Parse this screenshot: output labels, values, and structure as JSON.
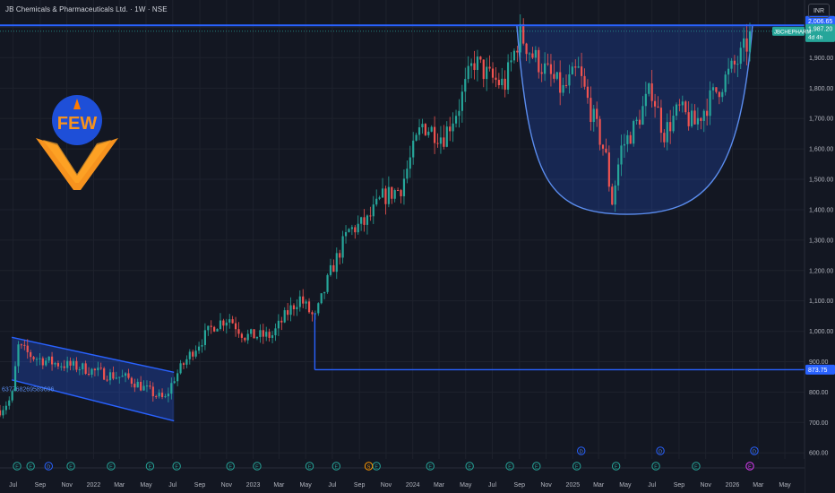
{
  "header": {
    "title": "JB Chemicals & Pharmaceuticals Ltd. · 1W · NSE",
    "currency": "INR"
  },
  "logo": {
    "text": "FEW"
  },
  "price_labels": {
    "resistance": "2,006.65",
    "last": "1,987.20",
    "ticker": "JBCHEPHARM",
    "countdown": "4d 4h",
    "support": "873.75",
    "channel_note": "637768269589696"
  },
  "colors": {
    "background": "#131722",
    "up": "#26a69a",
    "down": "#ef5350",
    "line": "#2962ff",
    "grid": "#1e222d",
    "axis_text": "#b2b5be"
  },
  "event_markers": {
    "earnings": [
      "Jul 2021",
      "Aug 2021",
      "Nov 2021",
      "Feb 2022",
      "May 2022",
      "Jul 2022",
      "Nov 2022",
      "Jan 2023",
      "May 2023",
      "Jul 2023",
      "Oct 2023",
      "Feb 2024",
      "May 2024",
      "Aug 2024",
      "Oct 2024",
      "Jan 2025",
      "Apr 2025",
      "Jul 2025",
      "Oct 2025",
      "Feb 2026"
    ],
    "dividends": [
      "Sep 2021",
      "Jan 2025",
      "Jul 2025",
      "Feb 2026"
    ],
    "splits": [
      "Sep 2023"
    ]
  },
  "chart_data": {
    "type": "candlestick",
    "title": "JB Chemicals & Pharmaceuticals Ltd. · 1W · NSE",
    "x_tick_labels": [
      "Jul",
      "Sep",
      "Nov",
      "2022",
      "Mar",
      "May",
      "Jul",
      "Sep",
      "Nov",
      "2023",
      "Mar",
      "May",
      "Jul",
      "Sep",
      "Nov",
      "2024",
      "Mar",
      "May",
      "Jul",
      "Sep",
      "Nov",
      "2025",
      "Mar",
      "May",
      "Jul",
      "Sep",
      "Nov",
      "2026",
      "Mar",
      "May"
    ],
    "y_ticks": [
      600,
      700,
      800,
      900,
      1000,
      1100,
      1200,
      1300,
      1400,
      1500,
      1600,
      1700,
      1800,
      1900,
      2000
    ],
    "y_tick_labels": [
      "600.00",
      "700.00",
      "800.00",
      "900.00",
      "1,000.00",
      "1,100.00",
      "1,200.00",
      "1,300.00",
      "1,400.00",
      "1,500.00",
      "1,600.00",
      "1,700.00",
      "1,800.00",
      "1,900.00"
    ],
    "ylim": [
      580,
      2090
    ],
    "xlim": [
      "2021-06-01",
      "2026-06-15"
    ],
    "grid": true,
    "price_key_points": [
      {
        "date": "2021-06-01",
        "price": 740
      },
      {
        "date": "2021-06-28",
        "price": 780
      },
      {
        "date": "2021-07-12",
        "price": 950
      },
      {
        "date": "2021-08-16",
        "price": 915
      },
      {
        "date": "2021-10-04",
        "price": 895
      },
      {
        "date": "2021-12-06",
        "price": 880
      },
      {
        "date": "2022-01-24",
        "price": 860
      },
      {
        "date": "2022-03-21",
        "price": 845
      },
      {
        "date": "2022-05-23",
        "price": 790
      },
      {
        "date": "2022-06-13",
        "price": 775
      },
      {
        "date": "2022-07-04",
        "price": 845
      },
      {
        "date": "2022-08-15",
        "price": 935
      },
      {
        "date": "2022-10-03",
        "price": 1020
      },
      {
        "date": "2022-11-07",
        "price": 1045
      },
      {
        "date": "2022-12-12",
        "price": 985
      },
      {
        "date": "2023-02-13",
        "price": 985
      },
      {
        "date": "2023-03-20",
        "price": 1060
      },
      {
        "date": "2023-04-17",
        "price": 1110
      },
      {
        "date": "2023-05-22",
        "price": 1040
      },
      {
        "date": "2023-06-26",
        "price": 1190
      },
      {
        "date": "2023-08-07",
        "price": 1330
      },
      {
        "date": "2023-09-18",
        "price": 1360
      },
      {
        "date": "2023-10-23",
        "price": 1440
      },
      {
        "date": "2023-12-04",
        "price": 1470
      },
      {
        "date": "2024-01-22",
        "price": 1680
      },
      {
        "date": "2024-03-11",
        "price": 1640
      },
      {
        "date": "2024-04-15",
        "price": 1740
      },
      {
        "date": "2024-05-20",
        "price": 1890
      },
      {
        "date": "2024-06-24",
        "price": 1835
      },
      {
        "date": "2024-07-29",
        "price": 1810
      },
      {
        "date": "2024-09-02",
        "price": 1980
      },
      {
        "date": "2024-09-30",
        "price": 1910
      },
      {
        "date": "2024-11-04",
        "price": 1850
      },
      {
        "date": "2024-12-09",
        "price": 1790
      },
      {
        "date": "2025-01-13",
        "price": 1860
      },
      {
        "date": "2025-02-10",
        "price": 1730
      },
      {
        "date": "2025-03-17",
        "price": 1580
      },
      {
        "date": "2025-03-31",
        "price": 1420
      },
      {
        "date": "2025-04-21",
        "price": 1600
      },
      {
        "date": "2025-05-26",
        "price": 1680
      },
      {
        "date": "2025-06-30",
        "price": 1800
      },
      {
        "date": "2025-07-28",
        "price": 1650
      },
      {
        "date": "2025-09-01",
        "price": 1730
      },
      {
        "date": "2025-10-06",
        "price": 1680
      },
      {
        "date": "2025-11-10",
        "price": 1760
      },
      {
        "date": "2025-12-15",
        "price": 1830
      },
      {
        "date": "2026-01-19",
        "price": 1900
      },
      {
        "date": "2026-02-09",
        "price": 1960
      },
      {
        "date": "2026-02-16",
        "price": 1987.2
      }
    ],
    "levels": [
      {
        "name": "resistance",
        "price": 2006.65
      },
      {
        "name": "support",
        "price": 873.75,
        "from": "2023-05-22"
      },
      {
        "name": "last",
        "price": 1987.2
      }
    ],
    "channel": {
      "upper": [
        {
          "date": "2021-06-28",
          "price": 980
        },
        {
          "date": "2022-07-04",
          "price": 865
        }
      ],
      "lower": [
        {
          "date": "2021-06-28",
          "price": 840
        },
        {
          "date": "2022-07-04",
          "price": 705
        }
      ]
    },
    "cup": {
      "left_rim": {
        "date": "2024-08-26",
        "price": 2006.65
      },
      "bottom": {
        "date": "2025-05-05",
        "price": 1385
      },
      "right_rim": {
        "date": "2026-02-16",
        "price": 2006.65
      }
    }
  }
}
